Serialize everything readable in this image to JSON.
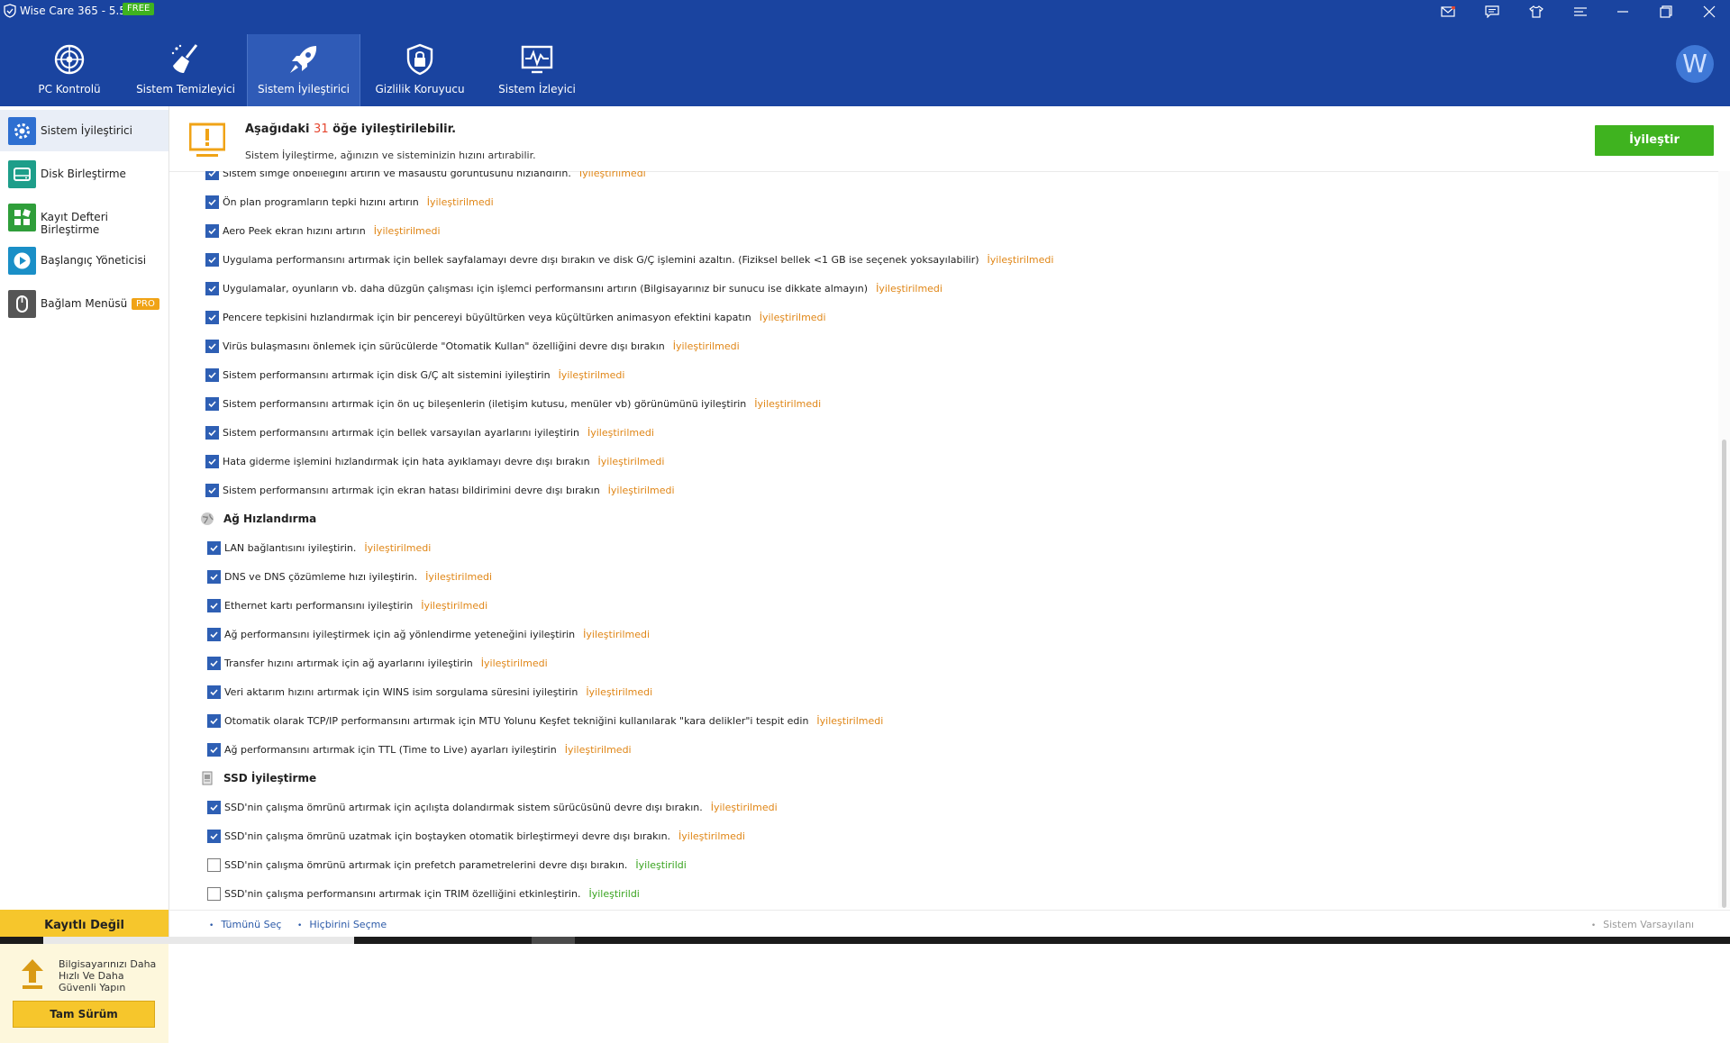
{
  "app": {
    "title": "Wise Care 365 - 5.5.9",
    "edition_badge": "FREE",
    "avatar_letter": "W"
  },
  "window_controls": [
    "mail-icon",
    "chat-icon",
    "shirt-icon",
    "menu-icon",
    "minimize-icon",
    "restore-icon",
    "close-icon"
  ],
  "nav": {
    "tabs": [
      {
        "label": "PC Kontrolü",
        "icon": "radar-icon"
      },
      {
        "label": "Sistem Temizleyici",
        "icon": "broom-icon"
      },
      {
        "label": "Sistem İyileştirici",
        "icon": "rocket-icon",
        "active": true
      },
      {
        "label": "Gizlilik Koruyucu",
        "icon": "lock-icon"
      },
      {
        "label": "Sistem İzleyici",
        "icon": "monitor-pulse-icon"
      }
    ]
  },
  "sidebar": {
    "items": [
      {
        "label": "Sistem İyileştirici",
        "icon": "gear-icon",
        "color": "#2e6fd1",
        "active": true
      },
      {
        "label": "Disk Birleştirme",
        "icon": "disk-icon",
        "color": "#1e9e8a"
      },
      {
        "label": "Kayıt Defteri Birleştirme",
        "icon": "blocks-icon",
        "color": "#2f9e3a"
      },
      {
        "label": "Başlangıç Yöneticisi",
        "icon": "play-icon",
        "color": "#1a8fc7"
      },
      {
        "label": "Bağlam Menüsü",
        "icon": "mouse-icon",
        "color": "#555555",
        "badge": "PRO"
      }
    ],
    "registration": {
      "title": "Kayıtlı Değil",
      "message": "Bilgisayarınızı Daha Hızlı Ve Daha Güvenli Yapın",
      "button": "Tam Sürüm"
    }
  },
  "summary": {
    "prefix": "Aşağıdaki",
    "count": "31",
    "suffix": "öğe iyileştirilebilir.",
    "subtitle": "Sistem İyileştirme, ağınızın ve sisteminizin hızını artırabilir.",
    "button": "İyileştir"
  },
  "list": {
    "top_items": [
      {
        "text": "Sistem simge önbelleğini artırın ve masaüstü görüntüsünü hızlandırın.",
        "status": "İyileştirilmedi",
        "checked": true
      },
      {
        "text": "Ön plan programların tepki hızını artırın",
        "status": "İyileştirilmedi",
        "checked": true
      },
      {
        "text": "Aero Peek ekran hızını artırın",
        "status": "İyileştirilmedi",
        "checked": true
      },
      {
        "text": "Uygulama performansını artırmak için bellek sayfalamayı devre dışı bırakın ve disk G/Ç işlemini azaltın. (Fiziksel bellek <1 GB ise seçenek yoksayılabilir)",
        "status": "İyileştirilmedi",
        "checked": true
      },
      {
        "text": "Uygulamalar, oyunların vb. daha düzgün çalışması için işlemci performansını artırın (Bilgisayarınız bir sunucu ise dikkate almayın)",
        "status": "İyileştirilmedi",
        "checked": true
      },
      {
        "text": "Pencere tepkisini hızlandırmak için bir pencereyi büyültürken veya küçültürken animasyon efektini kapatın",
        "status": "İyileştirilmedi",
        "checked": true
      },
      {
        "text": "Virüs bulaşmasını önlemek için sürücülerde \"Otomatik Kullan\" özelliğini devre dışı bırakın",
        "status": "İyileştirilmedi",
        "checked": true
      },
      {
        "text": "Sistem performansını artırmak için disk G/Ç alt sistemini iyileştirin",
        "status": "İyileştirilmedi",
        "checked": true
      },
      {
        "text": "Sistem performansını artırmak için ön uç bileşenlerin (iletişim kutusu, menüler vb) görünümünü iyileştirin",
        "status": "İyileştirilmedi",
        "checked": true
      },
      {
        "text": "Sistem performansını artırmak için bellek varsayılan ayarlarını iyileştirin",
        "status": "İyileştirilmedi",
        "checked": true
      },
      {
        "text": "Hata giderme işlemini hızlandırmak için hata ayıklamayı devre dışı bırakın",
        "status": "İyileştirilmedi",
        "checked": true
      },
      {
        "text": "Sistem performansını artırmak için ekran hatası bildirimini devre dışı bırakın",
        "status": "İyileştirilmedi",
        "checked": true
      }
    ],
    "network_section": {
      "title": "Ağ Hızlandırma",
      "icon": "globe-icon",
      "items": [
        {
          "text": "LAN bağlantısını iyileştirin.",
          "status": "İyileştirilmedi",
          "checked": true
        },
        {
          "text": "DNS ve DNS çözümleme hızı iyileştirin.",
          "status": "İyileştirilmedi",
          "checked": true
        },
        {
          "text": "Ethernet kartı performansını iyileştirin",
          "status": "İyileştirilmedi",
          "checked": true
        },
        {
          "text": "Ağ performansını iyileştirmek için ağ yönlendirme yeteneğini iyileştirin",
          "status": "İyileştirilmedi",
          "checked": true
        },
        {
          "text": "Transfer hızını artırmak için ağ ayarlarını iyileştirin",
          "status": "İyileştirilmedi",
          "checked": true
        },
        {
          "text": "Veri aktarım hızını artırmak için WINS isim sorgulama süresini iyileştirin",
          "status": "İyileştirilmedi",
          "checked": true
        },
        {
          "text": "Otomatik olarak TCP/IP performansını artırmak için MTU Yolunu Keşfet tekniğini kullanılarak \"kara delikler\"i tespit edin",
          "status": "İyileştirilmedi",
          "checked": true
        },
        {
          "text": "Ağ performansını artırmak için TTL (Time to Live) ayarları iyileştirin",
          "status": "İyileştirilmedi",
          "checked": true
        }
      ]
    },
    "ssd_section": {
      "title": "SSD İyileştirme",
      "icon": "ssd-icon",
      "items": [
        {
          "text": "SSD'nin çalışma ömrünü artırmak için açılışta dolandırmak sistem sürücüsünü devre dışı bırakın.",
          "status": "İyileştirilmedi",
          "checked": true
        },
        {
          "text": "SSD'nin çalışma ömrünü uzatmak için boştayken otomatik birleştirmeyi devre dışı bırakın.",
          "status": "İyileştirilmedi",
          "checked": true
        },
        {
          "text": "SSD'nin çalışma ömrünü artırmak için prefetch parametrelerini devre dışı bırakın.",
          "status": "İyileştirildi",
          "checked": false
        },
        {
          "text": "SSD'nin çalışma performansını artırmak için TRIM özelliğini etkinleştirin.",
          "status": "İyileştirildi",
          "checked": false
        }
      ]
    }
  },
  "footer": {
    "select_all": "Tümünü Seç",
    "select_none": "Hiçbirini Seçme",
    "defaults": "Sistem Varsayılanı"
  },
  "colors": {
    "header_bg": "#1a44a0",
    "accent_green": "#3fb31f",
    "status_pending": "#e08616",
    "status_done": "#3aa420",
    "count_red": "#e5462f",
    "registration_yellow": "#f6c62c"
  }
}
